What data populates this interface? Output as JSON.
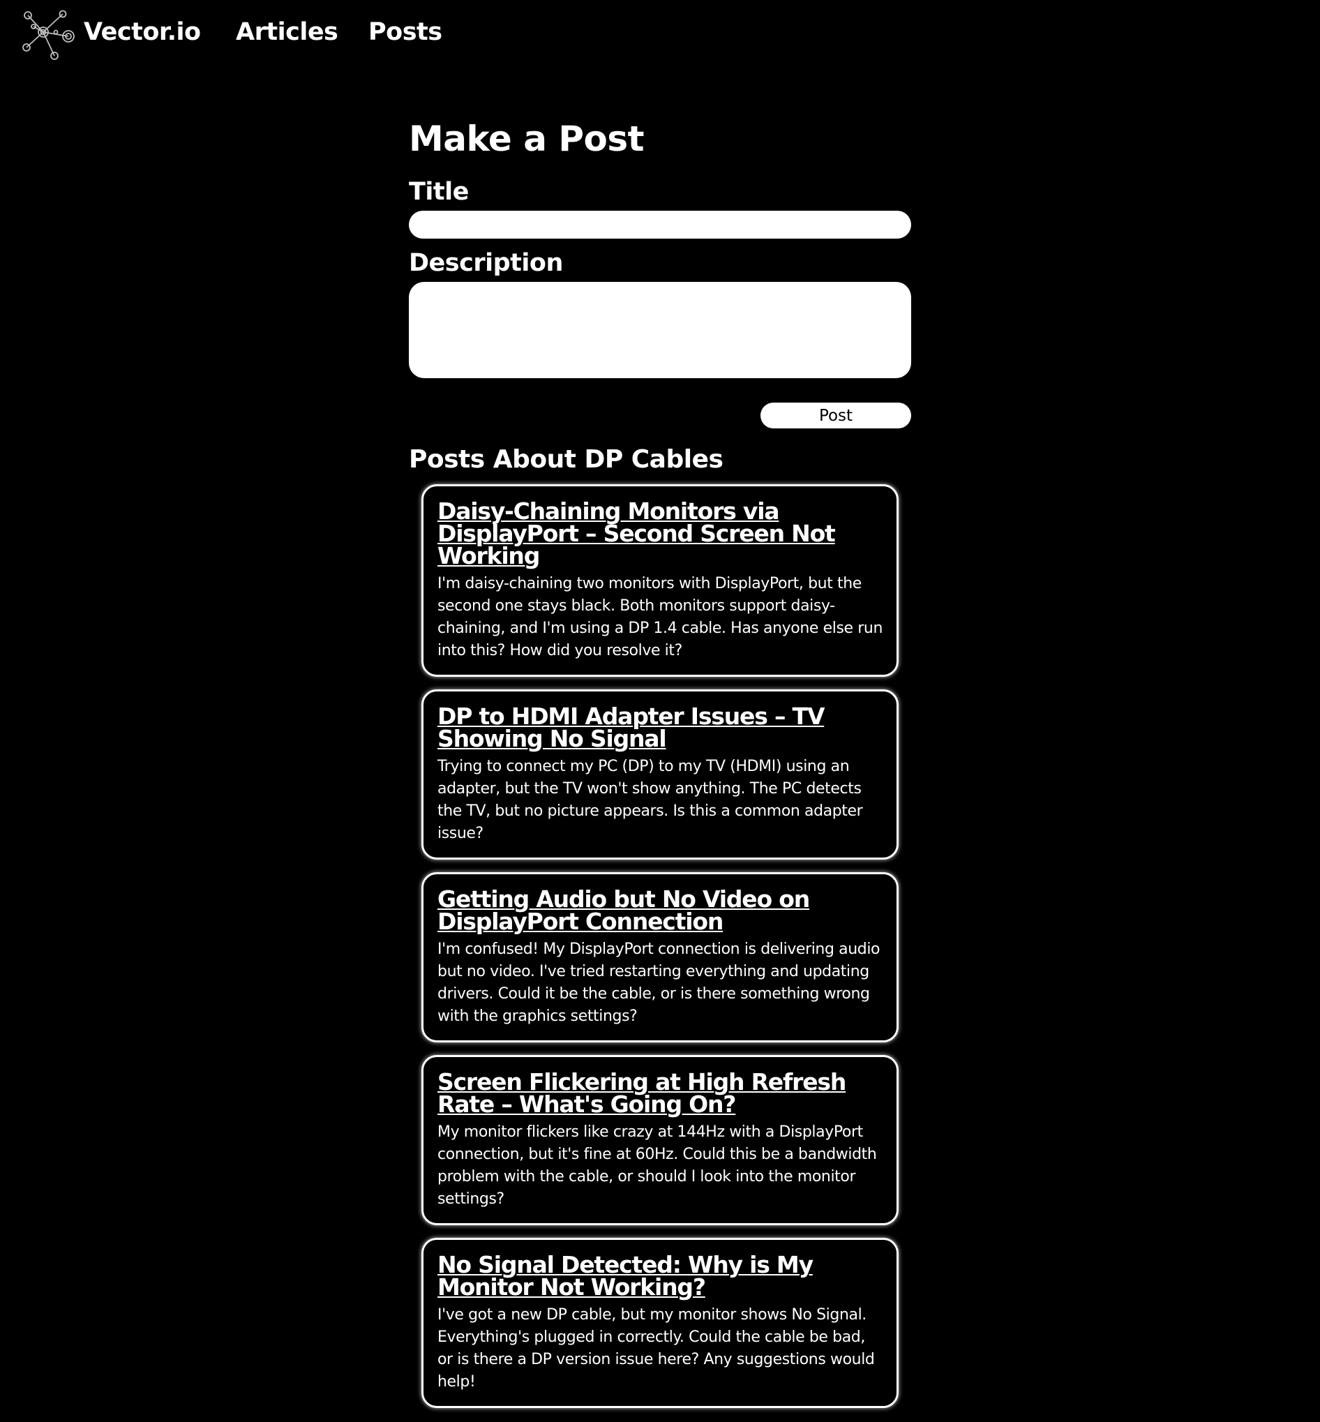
{
  "header": {
    "brand": "Vector.io",
    "nav": [
      {
        "label": "Articles"
      },
      {
        "label": "Posts"
      }
    ]
  },
  "form": {
    "heading": "Make a Post",
    "title_label": "Title",
    "title_value": "",
    "description_label": "Description",
    "description_value": "",
    "submit_label": "Post"
  },
  "posts_section": {
    "heading": "Posts About DP Cables",
    "posts": [
      {
        "title": "Daisy-Chaining Monitors via DisplayPort – Second Screen Not Working",
        "body": "I'm daisy-chaining two monitors with DisplayPort, but the second one stays black. Both monitors support daisy-chaining, and I'm using a DP 1.4 cable. Has anyone else run into this? How did you resolve it?"
      },
      {
        "title": "DP to HDMI Adapter Issues – TV Showing No Signal",
        "body": "Trying to connect my PC (DP) to my TV (HDMI) using an adapter, but the TV won't show anything. The PC detects the TV, but no picture appears. Is this a common adapter issue?"
      },
      {
        "title": "Getting Audio but No Video on DisplayPort Connection",
        "body": "I'm confused! My DisplayPort connection is delivering audio but no video. I've tried restarting everything and updating drivers. Could it be the cable, or is there something wrong with the graphics settings?"
      },
      {
        "title": "Screen Flickering at High Refresh Rate – What's Going On?",
        "body": "My monitor flickers like crazy at 144Hz with a DisplayPort connection, but it's fine at 60Hz. Could this be a bandwidth problem with the cable, or should I look into the monitor settings?"
      },
      {
        "title": "No Signal Detected: Why is My Monitor Not Working?",
        "body": "I've got a new DP cable, but my monitor shows No Signal. Everything's plugged in correctly. Could the cable be bad, or is there a DP version issue here? Any suggestions would help!"
      }
    ]
  }
}
